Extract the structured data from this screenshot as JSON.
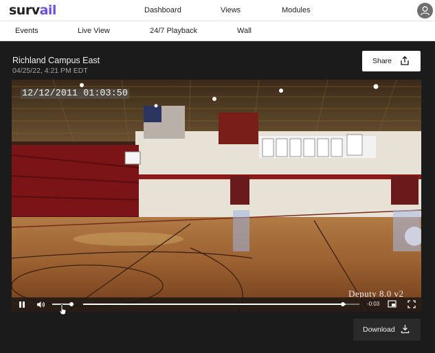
{
  "header": {
    "logo_prefix": "surv",
    "logo_accent": "ail",
    "nav": [
      {
        "label": "Dashboard"
      },
      {
        "label": "Views"
      },
      {
        "label": "Modules"
      }
    ]
  },
  "subnav": {
    "items": [
      {
        "label": "Events"
      },
      {
        "label": "Live View"
      },
      {
        "label": "24/7 Playback"
      },
      {
        "label": "Wall"
      }
    ]
  },
  "camera": {
    "title": "Richland Campus East",
    "timestamp": "04/25/22, 4:21 PM EDT"
  },
  "actions": {
    "share_label": "Share",
    "download_label": "Download"
  },
  "video": {
    "overlay_timestamp": "12/12/2011 01:03:50",
    "overlay_watermark": "Deputy 8.0 v2",
    "time_remaining": "-0:03",
    "progress": 0.95,
    "volume": 0.85,
    "state": "playing"
  },
  "colors": {
    "brand_accent": "#6b4fe0",
    "background_dark": "#1b1b1c"
  },
  "icons": [
    "user-icon",
    "share-icon",
    "pause-icon",
    "volume-icon",
    "picture-in-picture-icon",
    "fullscreen-icon",
    "download-icon",
    "pointer-cursor-icon"
  ]
}
